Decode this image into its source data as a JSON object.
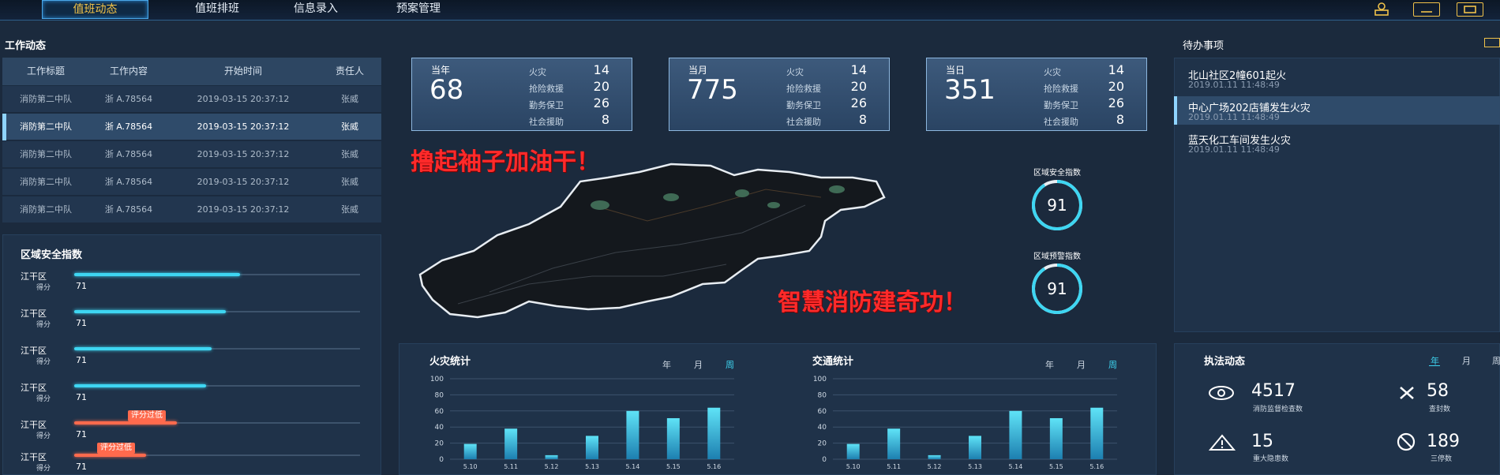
{
  "nav": {
    "items": [
      {
        "label": "值班动态",
        "active": true
      },
      {
        "label": "值班排班",
        "active": false
      },
      {
        "label": "信息录入",
        "active": false
      },
      {
        "label": "预案管理",
        "active": false
      }
    ]
  },
  "work": {
    "title": "工作动态",
    "columns": [
      "工作标题",
      "工作内容",
      "开始时间",
      "责任人"
    ],
    "rows": [
      [
        "消防第二中队",
        "浙 A.78564",
        "2019-03-15 20:37:12",
        "张威"
      ],
      [
        "消防第二中队",
        "浙 A.78564",
        "2019-03-15 20:37:12",
        "张威"
      ],
      [
        "消防第二中队",
        "浙 A.78564",
        "2019-03-15 20:37:12",
        "张威"
      ],
      [
        "消防第二中队",
        "浙 A.78564",
        "2019-03-15 20:37:12",
        "张威"
      ],
      [
        "消防第二中队",
        "浙 A.78564",
        "2019-03-15 20:37:12",
        "张威"
      ]
    ],
    "selected_row": 1
  },
  "safety": {
    "title": "区域安全指数",
    "score_label": "得分",
    "warn_label": "评分过低",
    "items": [
      {
        "district": "江干区",
        "score": "71",
        "level": 0.58,
        "warn": false
      },
      {
        "district": "江干区",
        "score": "71",
        "level": 0.53,
        "warn": false
      },
      {
        "district": "江干区",
        "score": "71",
        "level": 0.48,
        "warn": false
      },
      {
        "district": "江干区",
        "score": "71",
        "level": 0.46,
        "warn": false
      },
      {
        "district": "江干区",
        "score": "71",
        "level": 0.36,
        "warn": true
      },
      {
        "district": "江干区",
        "score": "71",
        "level": 0.25,
        "warn": true
      }
    ]
  },
  "stats": [
    {
      "label": "当年",
      "total": "68",
      "items": [
        {
          "name": "火灾",
          "value": "14"
        },
        {
          "name": "抢险救援",
          "value": "20"
        },
        {
          "name": "勤务保卫",
          "value": "26"
        },
        {
          "name": "社会援助",
          "value": "8"
        }
      ]
    },
    {
      "label": "当月",
      "total": "775",
      "items": [
        {
          "name": "火灾",
          "value": "14"
        },
        {
          "name": "抢险救援",
          "value": "20"
        },
        {
          "name": "勤务保卫",
          "value": "26"
        },
        {
          "name": "社会援助",
          "value": "8"
        }
      ]
    },
    {
      "label": "当日",
      "total": "351",
      "items": [
        {
          "name": "火灾",
          "value": "14"
        },
        {
          "name": "抢险救援",
          "value": "20"
        },
        {
          "name": "勤务保卫",
          "value": "26"
        },
        {
          "name": "社会援助",
          "value": "8"
        }
      ]
    }
  ],
  "slogans": {
    "top": "撸起袖子加油干！",
    "bottom": "智慧消防建奇功！"
  },
  "gauges": [
    {
      "title": "区域安全指数",
      "value": "91",
      "level": 0.91
    },
    {
      "title": "区域预警指数",
      "value": "91",
      "level": 0.91
    }
  ],
  "todo": {
    "title": "待办事项",
    "items": [
      {
        "title": "北山社区2幢601起火",
        "time": "2019.01.11 11:48:49"
      },
      {
        "title": "中心广场202店铺发生火灾",
        "time": "2019.01.11 11:48:49"
      },
      {
        "title": "蓝天化工车间发生火灾",
        "time": "2019.01.11 11:48:49"
      }
    ],
    "selected": 1
  },
  "chart_tabs": [
    "年",
    "月",
    "周"
  ],
  "chart_data": [
    {
      "type": "bar",
      "title": "火灾统计",
      "categories": [
        "5.10",
        "5.11",
        "5.12",
        "5.13",
        "5.14",
        "5.15",
        "5.16"
      ],
      "values": [
        19,
        38,
        5,
        29,
        60,
        51,
        64
      ],
      "yticks": [
        0,
        20,
        40,
        60,
        80,
        100
      ],
      "ylim": [
        0,
        100
      ],
      "active_tab": 2
    },
    {
      "type": "bar",
      "title": "交通统计",
      "categories": [
        "5.10",
        "5.11",
        "5.12",
        "5.13",
        "5.14",
        "5.15",
        "5.16"
      ],
      "values": [
        19,
        38,
        5,
        29,
        60,
        51,
        64
      ],
      "yticks": [
        0,
        20,
        40,
        60,
        80,
        100
      ],
      "ylim": [
        0,
        100
      ],
      "active_tab": 2
    }
  ],
  "law": {
    "title": "执法动态",
    "tabs": [
      "年",
      "月",
      "周"
    ],
    "active_tab": 0,
    "items": [
      {
        "icon": "eye-icon",
        "value": "4517",
        "label": "消防监督检查数"
      },
      {
        "icon": "close-icon",
        "value": "58",
        "label": "查封数"
      },
      {
        "icon": "warning-icon",
        "value": "15",
        "label": "重大隐患数"
      },
      {
        "icon": "ban-icon",
        "value": "189",
        "label": "三停数"
      }
    ]
  },
  "colors": {
    "accent": "#3ed6f2",
    "warn": "#ff6a4d",
    "nav_active": "#f0c24a",
    "slogan": "#ff2a2a"
  }
}
